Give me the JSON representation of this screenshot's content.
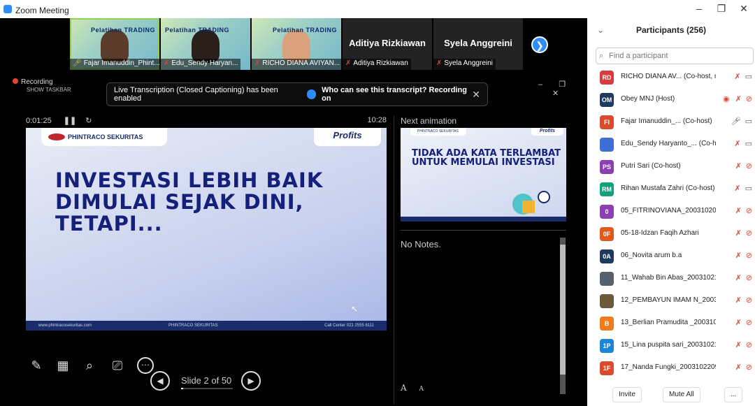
{
  "window": {
    "title": "Zoom Meeting",
    "controls": [
      "–",
      "❐",
      "✕"
    ]
  },
  "gallery": {
    "tiles": [
      {
        "name": "Fajar Imanuddin_Phint...",
        "mic": "on",
        "type": "video",
        "watermark": "Pelatihan TRADING"
      },
      {
        "name": "Edu_Sendy Haryan...",
        "mic": "muted",
        "type": "video",
        "watermark": "Pelatihan TRADING"
      },
      {
        "name": "RICHO DIANA AVIYAN...",
        "mic": "muted",
        "type": "video",
        "watermark": "Pelatihan TRADING"
      },
      {
        "name": "Aditiya Rizkiawan",
        "mic": "muted",
        "type": "name",
        "display": "Aditiya Rizkiawan"
      },
      {
        "name": "Syela Anggreini",
        "mic": "muted",
        "type": "name",
        "display": "Syela Anggreini"
      }
    ],
    "next_icon": "chevron-right-icon"
  },
  "recording": {
    "label": "Recording",
    "taskbar": "SHOW TASKBAR",
    "controls": [
      "–",
      "❐",
      "✕"
    ]
  },
  "caption_banner": {
    "text": "Live Transcription (Closed Captioning) has been enabled",
    "link": "Who can see this transcript? Recording on",
    "close": "✕"
  },
  "presenter": {
    "elapsed": "0:01:25",
    "clock": "10:28",
    "slide": {
      "brand_left": "PHINTRACO SEKURITAS",
      "brand_right": "Profits",
      "headline": "INVESTASI LEBIH BAIK DIMULAI SEJAK DINI, TETAPI...",
      "footer_left": "www.phintracosekuritas.com",
      "footer_center": "PHINTRACO SEKURITAS",
      "footer_right": "Call Center 021 2555 6111"
    },
    "next_label": "Next animation",
    "next_slide": {
      "brand_left": "PHINTRACO SEKURITAS",
      "brand_right": "Profits",
      "headline": "TIDAK ADA KATA TERLAMBAT UNTUK MEMULAI INVESTASI"
    },
    "notes": "No Notes.",
    "font_controls": [
      "A",
      "A"
    ],
    "slide_label": "Slide 2 of 50",
    "slide_progress": 0.04,
    "tools": [
      "pen-icon",
      "grid-icon",
      "magnifier-icon",
      "screen-icon",
      "more-icon"
    ]
  },
  "participants": {
    "title": "Participants (256)",
    "search_placeholder": "Find a participant",
    "rows": [
      {
        "initials": "RD",
        "color": "#d73b3e",
        "name": "RICHO DIANA AV... (Co-host, me)",
        "mic": "muted",
        "cam": "on"
      },
      {
        "initials": "OM",
        "color": "#1f3a5f",
        "name": "Obey MNJ (Host)",
        "mic": "muted",
        "cam": "off",
        "rec": true
      },
      {
        "initials": "FI",
        "color": "#d94b2b",
        "name": "Fajar Imanuddin_... (Co-host)",
        "mic": "on",
        "cam": "on"
      },
      {
        "initials": "",
        "color": "#3f6fd6",
        "name": "Edu_Sendy Haryanto_... (Co-host)",
        "mic": "muted",
        "cam": "on"
      },
      {
        "initials": "PS",
        "color": "#8b3fb2",
        "name": "Putri Sari (Co-host)",
        "mic": "muted",
        "cam": "off"
      },
      {
        "initials": "RM",
        "color": "#10a17a",
        "name": "Rihan Mustafa Zahri (Co-host)",
        "mic": "muted",
        "cam": "on"
      },
      {
        "initials": "0",
        "color": "#8b3fb2",
        "name": "05_FITRINOVIANA_2003102033",
        "mic": "muted",
        "cam": "off"
      },
      {
        "initials": "0F",
        "color": "#e05a1e",
        "name": "05-18-Idzan Faqih Azhari",
        "mic": "muted",
        "cam": "off"
      },
      {
        "initials": "0A",
        "color": "#1f3a5f",
        "name": "06_Novita arum b.a",
        "mic": "muted",
        "cam": "off"
      },
      {
        "initials": "",
        "color": "#55626e",
        "name": "11_Wahab Bin Abas_2003102100",
        "mic": "muted",
        "cam": "off"
      },
      {
        "initials": "",
        "color": "#6b5a3a",
        "name": "12_PEMBAYUN IMAM N_20031...",
        "mic": "muted",
        "cam": "off"
      },
      {
        "initials": "B",
        "color": "#f07b1e",
        "name": "13_Berlian Pramudita _2003102...",
        "mic": "muted",
        "cam": "off"
      },
      {
        "initials": "1P",
        "color": "#1b86d6",
        "name": "15_Lina puspita sari_2003102175",
        "mic": "muted",
        "cam": "off"
      },
      {
        "initials": "1F",
        "color": "#d94b2b",
        "name": "17_Nanda Fungki_2003102209",
        "mic": "muted",
        "cam": "off"
      }
    ],
    "footer": {
      "invite": "Invite",
      "mute_all": "Mute All",
      "more": "..."
    }
  }
}
